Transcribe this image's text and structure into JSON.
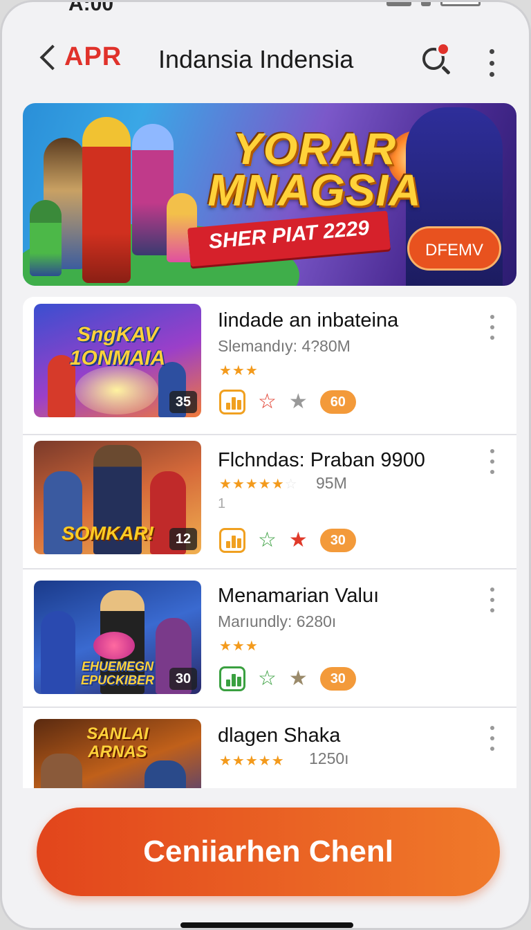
{
  "status_bar": {
    "time": "A:00"
  },
  "app_bar": {
    "back_label": "APR",
    "title": "Indansia Indensia"
  },
  "banner": {
    "title_line1": "YORAR",
    "title_line2": "MNAGSIA",
    "ribbon_text": "SHER PIAT 2229",
    "button_label": "DFEMV"
  },
  "items": [
    {
      "thumb_text_1": "SngKAV",
      "thumb_text_2": "1ONMAIA",
      "badge": "35",
      "title": "Iindade an inbateina",
      "subtitle": "Slemandıy: 4?80M",
      "stars": "★★★",
      "stars_dim": "",
      "extra_line": "",
      "count": "60"
    },
    {
      "thumb_text_1": "SOMKAR!",
      "thumb_text_2": "",
      "badge": "12",
      "title": "Flchndas: Praban 9900",
      "subtitle": "95M",
      "stars": "★★★★★",
      "stars_dim": "☆",
      "extra_line": "1",
      "count": "30"
    },
    {
      "thumb_text_1": "EHUEMEGN",
      "thumb_text_2": "EPUCKIBER",
      "badge": "30",
      "title": "Menamarian Valuı",
      "subtitle": "Marıundly: 6280ı",
      "stars": "★★★",
      "stars_dim": "",
      "extra_line": "",
      "count": "30"
    },
    {
      "thumb_text_1": "SANLAI",
      "thumb_text_2": "ARNAS",
      "badge": "",
      "title": "dlagen Shaka",
      "subtitle": "1250ı",
      "stars": "★★★★★",
      "stars_dim": "",
      "extra_line": "",
      "count": ""
    }
  ],
  "cta_label": "Ceniiarhen Chenl",
  "colors": {
    "accent": "#e0322b",
    "cta": "#e8521f",
    "pill": "#f39a3a"
  }
}
